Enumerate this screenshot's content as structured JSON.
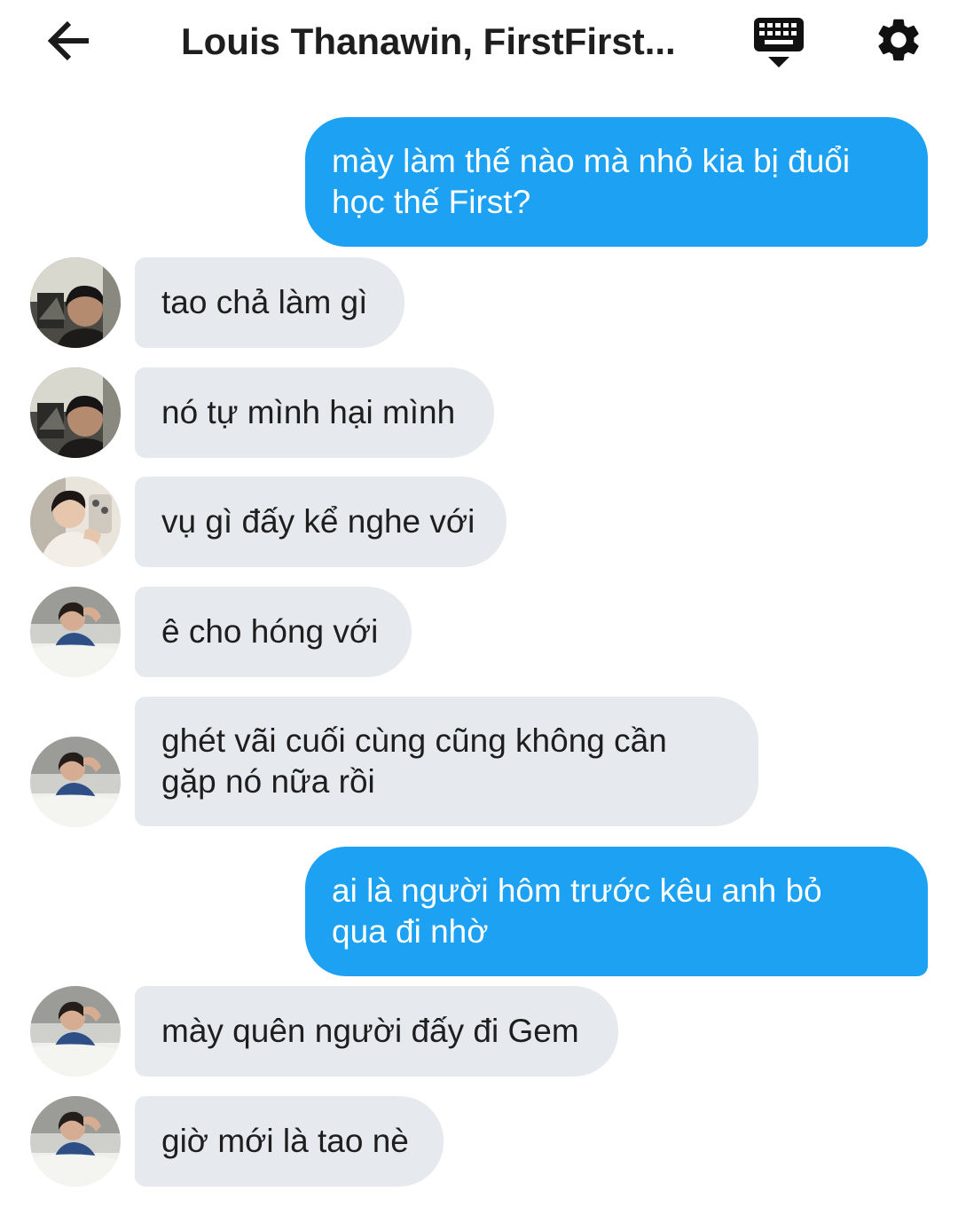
{
  "header": {
    "title": "Louis Thanawin, FirstFirst...",
    "back_icon": "arrow-left-icon",
    "keyboard_icon": "keyboard-icon",
    "settings_icon": "gear-icon"
  },
  "colors": {
    "outgoing_bubble": "#1da1f2",
    "incoming_bubble": "#e6e9ed"
  },
  "messages": [
    {
      "direction": "out",
      "lines": [
        "mày làm thế nào mà nhỏ kia bị đuổi",
        "học thế First?"
      ]
    },
    {
      "direction": "in",
      "avatar": "avatar-1",
      "lines": [
        "tao chả làm gì"
      ]
    },
    {
      "direction": "in",
      "avatar": "avatar-1",
      "lines": [
        "nó tự mình hại mình"
      ]
    },
    {
      "direction": "in",
      "avatar": "avatar-2",
      "lines": [
        "vụ gì đấy kể nghe với"
      ]
    },
    {
      "direction": "in",
      "avatar": "avatar-3",
      "lines": [
        "ê cho hóng với"
      ]
    },
    {
      "direction": "in",
      "avatar": "avatar-3",
      "lines": [
        "ghét vãi cuối cùng cũng không cần",
        "gặp nó nữa rồi"
      ]
    },
    {
      "direction": "out",
      "lines": [
        "ai là người hôm trước kêu anh bỏ",
        "qua đi nhờ"
      ]
    },
    {
      "direction": "in",
      "avatar": "avatar-3",
      "lines": [
        "mày quên người đấy đi Gem"
      ]
    },
    {
      "direction": "in",
      "avatar": "avatar-3",
      "lines": [
        "giờ mới là tao nè"
      ]
    }
  ]
}
